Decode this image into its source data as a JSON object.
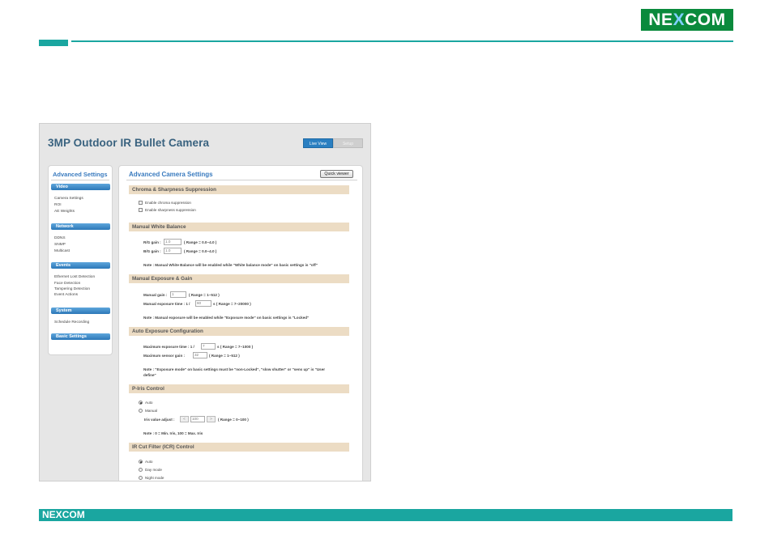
{
  "slide": {
    "brand_top": [
      "NE",
      "X",
      "COM"
    ],
    "brand_bottom": [
      "NE",
      "X",
      "COM"
    ]
  },
  "ui": {
    "camera_title": "3MP Outdoor IR Bullet Camera",
    "tabs": {
      "live_view": "Live View",
      "setup": "Setup"
    },
    "sidebar": {
      "title": "Advanced Settings",
      "groups": [
        {
          "label": "Video",
          "items": [
            "Camera Settings",
            "ROI",
            "AE Weights"
          ]
        },
        {
          "label": "Network",
          "items": [
            "DDNS",
            "SNMP",
            "Multicast"
          ]
        },
        {
          "label": "Events",
          "items": [
            "Ethernet Lost Detection",
            "Face Detection",
            "Tampering Detection",
            "Event Actions"
          ]
        },
        {
          "label": "System",
          "items": [
            "Schedule Recording"
          ]
        },
        {
          "label": "Basic Settings",
          "items": []
        }
      ]
    },
    "main": {
      "title": "Advanced Camera Settings",
      "quick_viewer": "Quick viewer",
      "chroma": {
        "header": "Chroma & Sharpness Suppression",
        "opt1": "Enable chroma suppression",
        "opt2": "Enable sharpness suppression"
      },
      "wb": {
        "header": "Manual White Balance",
        "rg_label": "R/G gain :",
        "rg_value": "1.0",
        "rg_range": "( Range = 0.0~4.0 )",
        "bg_label": "B/G gain :",
        "bg_value": "1.0",
        "bg_range": "( Range = 0.0~4.0 )",
        "note": "Note : Manual White Balance will be enabled while \"White balance mode\" on basic settings is \"off\""
      },
      "exposure": {
        "header": "Manual Exposure & Gain",
        "gain_label": "Manual gain :",
        "gain_value": "1",
        "gain_range": "( Range = 1~512 )",
        "time_label": "Manual exposure time : 1 /",
        "time_value": "60",
        "time_range": "s ( Range = 7~20000 )",
        "note": "Note : Manual exposure will be enabled while \"Exposure mode\" on basic settings is \"Locked\""
      },
      "auto_exp": {
        "header": "Auto Exposure Configuration",
        "max_time_label": "Maximum exposure time : 1 /",
        "max_time_value": "7",
        "max_time_range": "s ( Range = 7~1000 )",
        "max_gain_label": "Maximum sensor gain :",
        "max_gain_value": "32",
        "max_gain_range": "( Range = 1~512 )",
        "note1": "Note : \"Exposure mode\" on basic settings must be \"non-Locked\", \"slow shutter\" or \"sens up\" is \"User",
        "note2": "define\""
      },
      "piris": {
        "header": "P-Iris Control",
        "auto": "Auto",
        "manual": "Manual",
        "adjust_label": "Iris value adjust :",
        "dec": "<",
        "value": "100",
        "inc": ">",
        "range": "( Range = 0~100 )",
        "note": "Note : 0 = Min. Iris, 100 = Max. Iris"
      },
      "ir": {
        "header": "IR Cut Filter (ICR) Control",
        "auto": "Auto",
        "day": "Day mode",
        "night": "Night mode"
      }
    }
  }
}
